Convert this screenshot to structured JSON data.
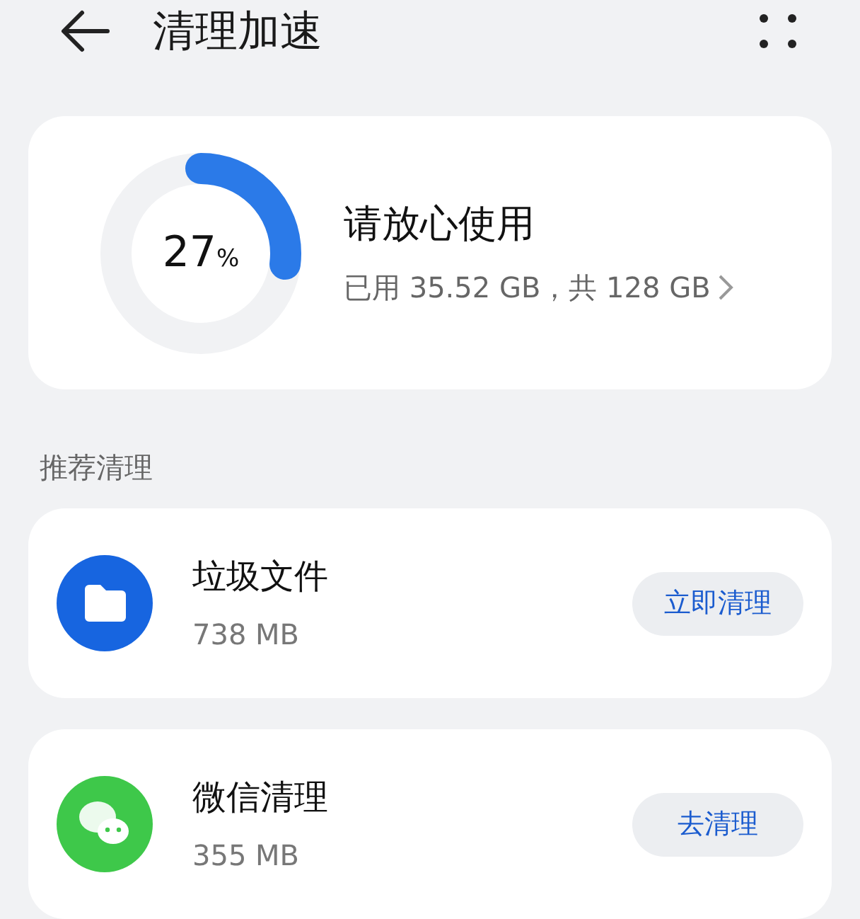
{
  "header": {
    "title": "清理加速"
  },
  "storage": {
    "percent": "27",
    "unit": "%",
    "level": 0.27,
    "status": "请放心使用",
    "usage": "已用 35.52 GB，共 128 GB"
  },
  "section_title": "推荐清理",
  "items": [
    {
      "kind": "junk",
      "name": "垃圾文件",
      "size": "738 MB",
      "action": "立即清理"
    },
    {
      "kind": "wechat",
      "name": "微信清理",
      "size": "355 MB",
      "action": "去清理"
    }
  ]
}
